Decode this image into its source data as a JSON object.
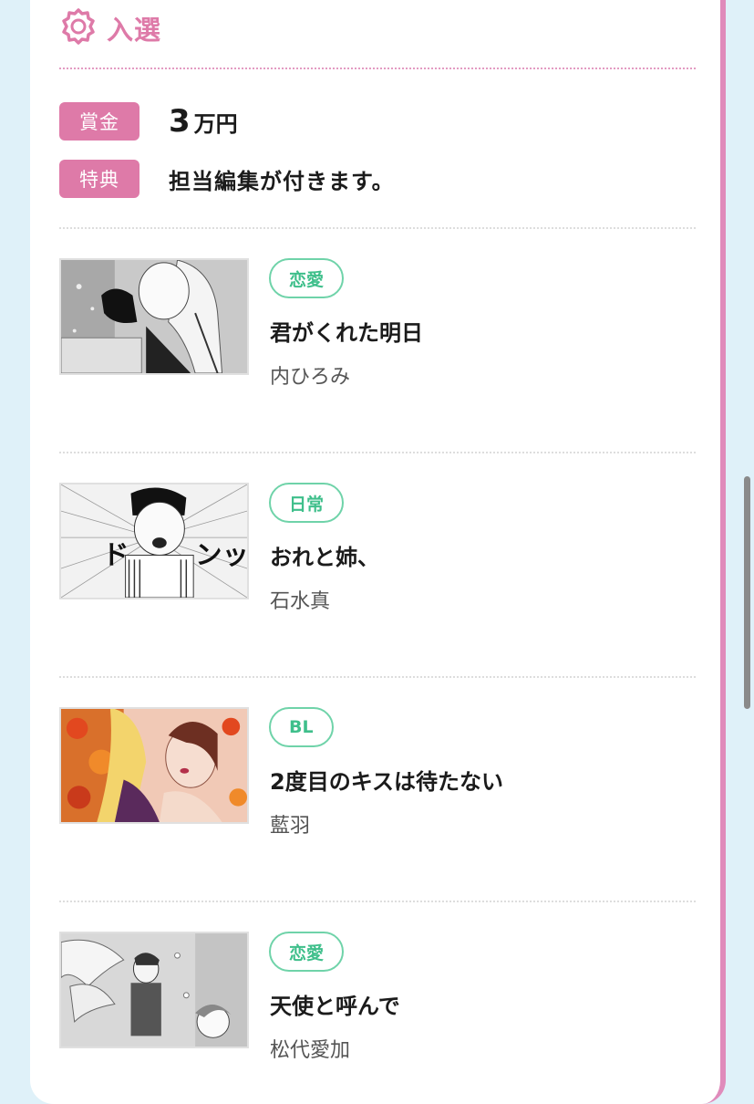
{
  "section": {
    "title": "入選",
    "icon": "award-icon",
    "accent_color": "#de7aa8"
  },
  "prizes": [
    {
      "label": "賞金",
      "amount_number": "3",
      "amount_unit": "万円"
    },
    {
      "label": "特典",
      "text": "担当編集が付きます。"
    }
  ],
  "entries": [
    {
      "genre": "恋愛",
      "title": "君がくれた明日",
      "author": "内ひろみ",
      "thumbnail": "manga-thumbnail-grayscale"
    },
    {
      "genre": "日常",
      "title": "おれと姉、",
      "author": "石水真",
      "thumbnail": "manga-thumbnail-grayscale"
    },
    {
      "genre": "BL",
      "title": "2度目のキスは待たない",
      "author": "藍羽",
      "thumbnail": "manga-thumbnail-color"
    },
    {
      "genre": "恋愛",
      "title": "天使と呼んで",
      "author": "松代愛加",
      "thumbnail": "manga-thumbnail-grayscale"
    }
  ],
  "colors": {
    "page_background": "#dff1f9",
    "genre_tag": "#6fd3a9",
    "label_background": "#de7aa8"
  }
}
